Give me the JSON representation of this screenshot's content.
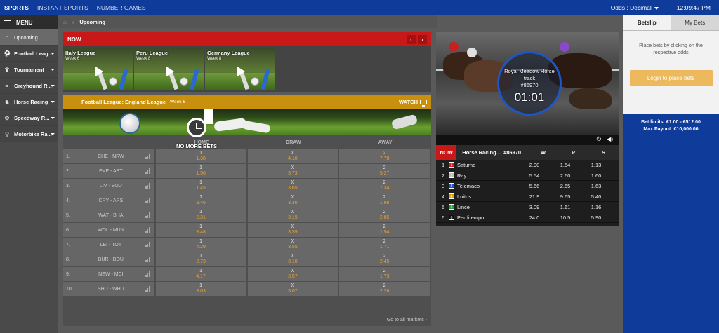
{
  "topbar": {
    "nav": [
      "SPORTS",
      "INSTANT SPORTS",
      "NUMBER GAMES"
    ],
    "odds_label": "Odds : Decimal",
    "time": "12:09:47 PM"
  },
  "sidebar": {
    "menu_label": "MENU",
    "items": [
      {
        "label": "Upcoming",
        "icon": "home-icon"
      },
      {
        "label": "Football Leag...",
        "icon": "football-icon"
      },
      {
        "label": "Tournament",
        "icon": "trophy-icon"
      },
      {
        "label": "Greyhound R...",
        "icon": "greyhound-icon"
      },
      {
        "label": "Horse Racing",
        "icon": "horse-icon"
      },
      {
        "label": "Speedway R...",
        "icon": "speedway-icon"
      },
      {
        "label": "Motorbike Ra...",
        "icon": "motorbike-icon"
      }
    ]
  },
  "breadcrumb": {
    "current": "Upcoming"
  },
  "now_panel": {
    "label": "NOW",
    "thumbs": [
      {
        "title": "Italy League",
        "week": "Week 6"
      },
      {
        "title": "Peru League",
        "week": "Week 8"
      },
      {
        "title": "Germany League",
        "week": "Week 8"
      }
    ]
  },
  "league": {
    "title": "Football League: England League",
    "week": "Week 6",
    "watch": "WATCH",
    "col_home": "HOME",
    "col_draw": "DRAW",
    "col_away": "AWAY",
    "no_more_bets": "NO MORE BETS",
    "goto_label": "Go to all markets",
    "matches": [
      {
        "num": "1.",
        "teams": "CHE  -  NRW",
        "home": "1.38",
        "draw": "4.10",
        "away": "7.78"
      },
      {
        "num": "2.",
        "teams": "EVE  -  AST",
        "home": "1.56",
        "draw": "3.73",
        "away": "5.27"
      },
      {
        "num": "3.",
        "teams": "LIV  -  SOU",
        "home": "1.45",
        "draw": "3.65",
        "away": "7.34"
      },
      {
        "num": "4.",
        "teams": "CRY  -  ARS",
        "home": "3.46",
        "draw": "3.30",
        "away": "1.98"
      },
      {
        "num": "5.",
        "teams": "WAT  -  BHA",
        "home": "2.31",
        "draw": "3.19",
        "away": "2.85"
      },
      {
        "num": "6.",
        "teams": "WOL  -  MUN",
        "home": "3.48",
        "draw": "3.39",
        "away": "1.94"
      },
      {
        "num": "7.",
        "teams": "LEI  -  TOT",
        "home": "4.29",
        "draw": "3.55",
        "away": "1.71"
      },
      {
        "num": "8.",
        "teams": "BUR  -  BOU",
        "home": "2.73",
        "draw": "3.10",
        "away": "2.45"
      },
      {
        "num": "9.",
        "teams": "NEW  -  MCI",
        "home": "4.17",
        "draw": "3.57",
        "away": "1.73"
      },
      {
        "num": "10.",
        "teams": "SHU  -  WHU",
        "home": "3.03",
        "draw": "3.07",
        "away": "2.26"
      }
    ]
  },
  "race": {
    "track": "Royal Meadow Horse track",
    "race_id": "#86970",
    "countdown": "01:01",
    "now": "NOW",
    "title": "Horse Racing...",
    "col_w": "W",
    "col_p": "P",
    "col_s": "S",
    "runners": [
      {
        "n": "1",
        "name": "Saturno",
        "w": "2.90",
        "p": "1.54",
        "s": "1.13",
        "color": "#d82020"
      },
      {
        "n": "2",
        "name": "Ray",
        "w": "5.54",
        "p": "2.60",
        "s": "1.60",
        "color": "#bbbbbb"
      },
      {
        "n": "3",
        "name": "Telemaco",
        "w": "5.66",
        "p": "2.65",
        "s": "1.63",
        "color": "#1f4fd0"
      },
      {
        "n": "4",
        "name": "Luitos",
        "w": "21.9",
        "p": "9.65",
        "s": "5.40",
        "color": "#e09a10"
      },
      {
        "n": "5",
        "name": "Lince",
        "w": "3.09",
        "p": "1.61",
        "s": "1.16",
        "color": "#20a030"
      },
      {
        "n": "6",
        "name": "Perditempo",
        "w": "24.0",
        "p": "10.5",
        "s": "5.90",
        "color": "#111111"
      }
    ]
  },
  "betslip": {
    "tab_betslip": "Betslip",
    "tab_mybets": "My Bets",
    "message": "Place bets by clicking on the respective odds",
    "login": "Login to place bets",
    "limits": "Bet limits :€1.00 - €512.00",
    "max_payout": "Max Payout :€10,000.00"
  }
}
